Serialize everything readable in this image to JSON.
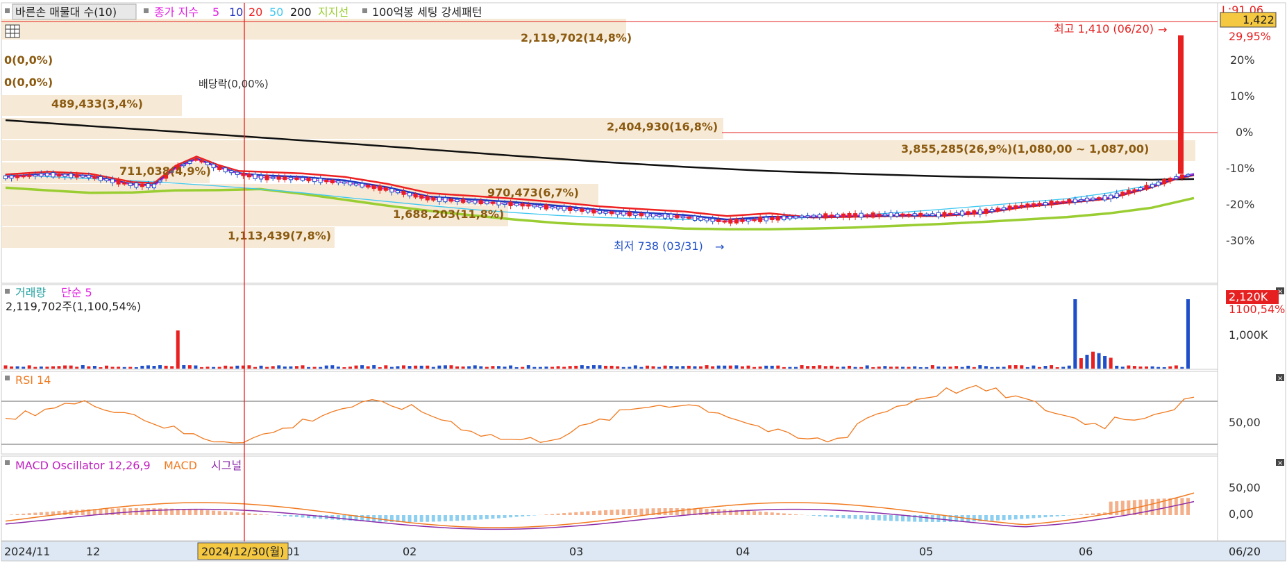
{
  "colors": {
    "up": "#e8201f",
    "down": "#1f4fc8",
    "ma5": "#e020e0",
    "ma10": "#2030c0",
    "ma20": "#ee2020",
    "ma50": "#40c8f0",
    "ma200": "#101010",
    "support": "#9acd32",
    "band": "#f5e6cf",
    "bandText": "#8b5a10",
    "volMa": "#e020e0",
    "rsi": "#f07a20",
    "macd": "#f07a20",
    "signal": "#8a2aa8",
    "oscPos": "#f4b08a",
    "oscNeg": "#8ccff0",
    "cursor": "#e62020",
    "highlight": "#f5c842",
    "panelBorder": "#c8c8c8"
  },
  "legend": {
    "main": {
      "prefix_icon": "square-icon",
      "title": "바른손 매물대 수(10)",
      "ma_label": "종가 지수",
      "ma5": "5",
      "ma10": "10",
      "ma20": "20",
      "ma50": "50",
      "ma200": "200",
      "support": "지지선",
      "pattern_icon": "square-icon",
      "pattern": "100억봉 세팅 강세패턴"
    },
    "volume": {
      "title": "거래량",
      "ma": "단순 5",
      "info": "2,119,702주(1,100,54%)"
    },
    "rsi": {
      "title": "RSI 14"
    },
    "macd": {
      "title": "MACD Oscillator 12,26,9",
      "macd": "MACD",
      "signal": "시그널"
    }
  },
  "price_axis": {
    "top_label": "L:91,06",
    "current": "1,422",
    "current_pct": "29,95%",
    "ticks": [
      "20%",
      "10%",
      "0%",
      "-10%",
      "-20%",
      "-30%"
    ]
  },
  "volume_axis": {
    "current": "2,120K",
    "current_pct": "1100,54%",
    "tick": "1,000K"
  },
  "rsi_axis": {
    "tick": "50,00"
  },
  "macd_axis": {
    "ticks": [
      "50,00",
      "0,00"
    ]
  },
  "x_axis": {
    "labels": [
      "2024/11",
      "12",
      "01",
      "02",
      "03",
      "04",
      "05",
      "06"
    ],
    "right_label": "06/20",
    "cursor_label": "2024/12/30(월)"
  },
  "annotations": {
    "high": "최고 1,410 (06/20)",
    "low": "최저 738 (03/31)",
    "dividend": "배당락(0,00%)"
  },
  "volume_profile": [
    {
      "label": "2,119,702(14,8%)"
    },
    {
      "label": "0(0,0%)"
    },
    {
      "label": "0(0,0%)"
    },
    {
      "label": "489,433(3,4%)"
    },
    {
      "label": "2,404,930(16,8%)"
    },
    {
      "label": "3,855,285(26,9%)(1,080,00 ~ 1,087,00)"
    },
    {
      "label": "711,038(4,9%)"
    },
    {
      "label": "970,473(6,7%)"
    },
    {
      "label": "1,688,203(11,8%)"
    },
    {
      "label": "1,113,439(7,8%)"
    }
  ],
  "chart_data": [
    {
      "type": "line",
      "title": "바른손 매물대 수(10)",
      "price_range": [
        700,
        1450
      ],
      "ma_series": {
        "ma50": [
          [
            0,
            1008
          ],
          [
            1,
            1002
          ],
          [
            2,
            996
          ],
          [
            3,
            990
          ],
          [
            4,
            983
          ],
          [
            5,
            975
          ],
          [
            6,
            966
          ],
          [
            7,
            955
          ],
          [
            8,
            942
          ],
          [
            9,
            930
          ],
          [
            10,
            918
          ],
          [
            11,
            907
          ],
          [
            12,
            898
          ],
          [
            13,
            890
          ],
          [
            14,
            884
          ],
          [
            15,
            880
          ],
          [
            16,
            878
          ],
          [
            17,
            878
          ],
          [
            18,
            880
          ],
          [
            19,
            884
          ],
          [
            20,
            890
          ],
          [
            21,
            898
          ],
          [
            22,
            907
          ],
          [
            23,
            917
          ],
          [
            24,
            928
          ],
          [
            25,
            938
          ],
          [
            26,
            955
          ],
          [
            27,
            978
          ],
          [
            28,
            1012
          ]
        ],
        "ma200": [
          [
            0,
            1165
          ],
          [
            2,
            1148
          ],
          [
            4,
            1132
          ],
          [
            6,
            1115
          ],
          [
            8,
            1098
          ],
          [
            10,
            1080
          ],
          [
            12,
            1062
          ],
          [
            14,
            1045
          ],
          [
            16,
            1030
          ],
          [
            18,
            1018
          ],
          [
            20,
            1010
          ],
          [
            22,
            1003
          ],
          [
            24,
            998
          ],
          [
            26,
            995
          ],
          [
            27,
            993
          ],
          [
            28,
            995
          ]
        ],
        "support": [
          [
            0,
            970
          ],
          [
            1,
            962
          ],
          [
            2,
            955
          ],
          [
            3,
            956
          ],
          [
            4,
            962
          ],
          [
            5,
            963
          ],
          [
            6,
            966
          ],
          [
            7,
            952
          ],
          [
            8,
            935
          ],
          [
            9,
            918
          ],
          [
            10,
            903
          ],
          [
            11,
            890
          ],
          [
            12,
            878
          ],
          [
            13,
            868
          ],
          [
            14,
            862
          ],
          [
            15,
            858
          ],
          [
            16,
            852
          ],
          [
            17,
            850
          ],
          [
            18,
            850
          ],
          [
            19,
            852
          ],
          [
            20,
            855
          ],
          [
            21,
            860
          ],
          [
            22,
            865
          ],
          [
            23,
            871
          ],
          [
            24,
            878
          ],
          [
            25,
            885
          ],
          [
            26,
            896
          ],
          [
            27,
            912
          ],
          [
            28,
            940
          ]
        ]
      }
    },
    {
      "type": "bar",
      "title": "거래량",
      "series": [
        {
          "name": "거래량",
          "values": []
        }
      ]
    },
    {
      "type": "line",
      "title": "RSI 14",
      "ylim": [
        0,
        100
      ]
    },
    {
      "type": "line",
      "title": "MACD Oscillator 12,26,9",
      "series": [
        {
          "name": "MACD"
        },
        {
          "name": "시그널"
        }
      ]
    }
  ]
}
